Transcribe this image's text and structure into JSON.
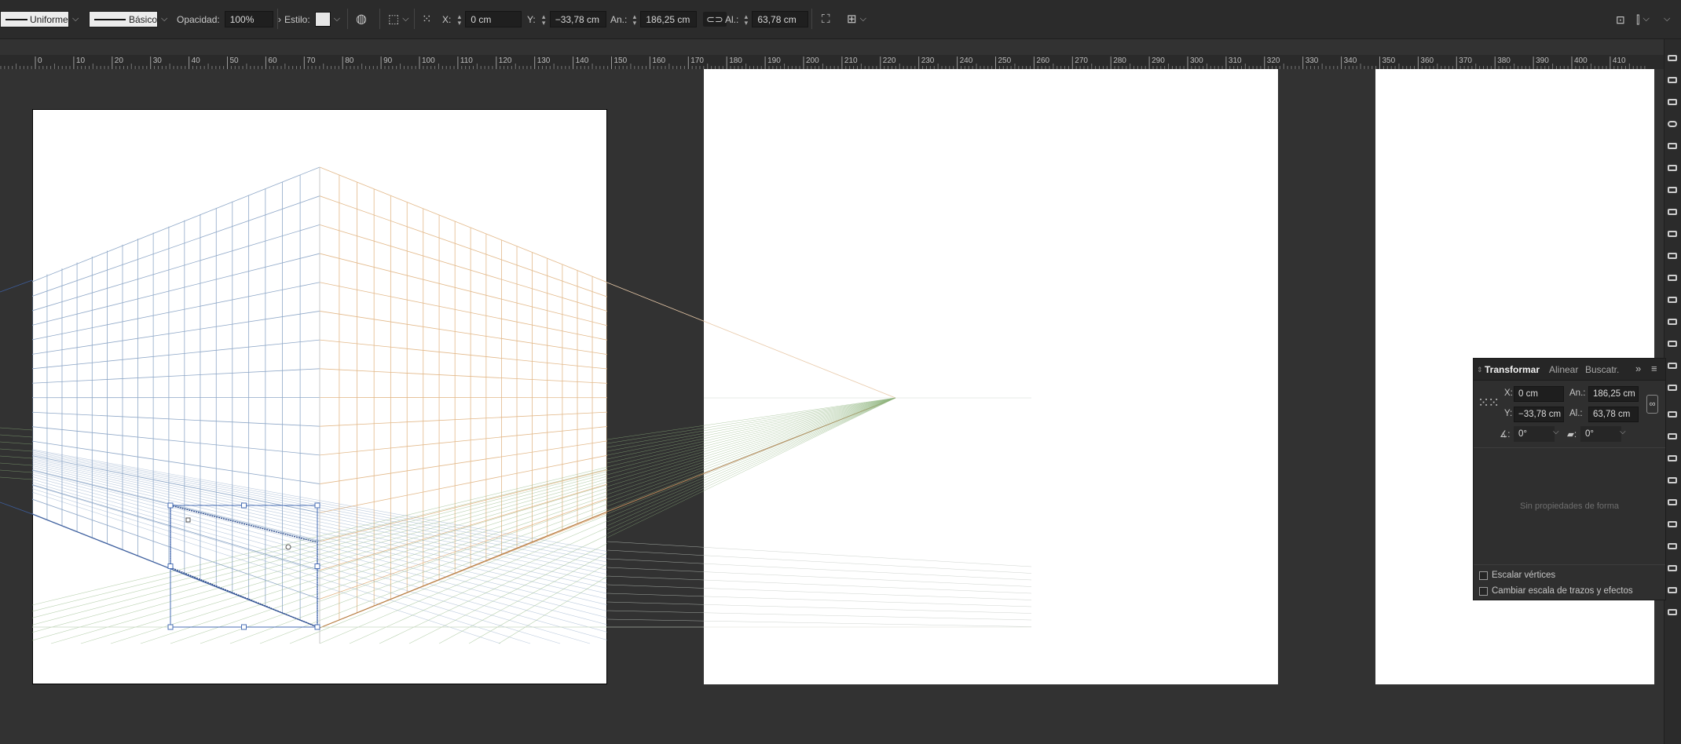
{
  "control_bar": {
    "stroke_profile": "Uniforme",
    "brush": "Básico",
    "opacity_label": "Opacidad:",
    "opacity_value": "100%",
    "style_label": "Estilo:",
    "x_label": "X:",
    "x_value": "0 cm",
    "y_label": "Y:",
    "y_value": "−33,78 cm",
    "width_label": "An.:",
    "width_value": "186,25 cm",
    "height_label": "Al.:",
    "height_value": "63,78 cm"
  },
  "ruler": {
    "ticks": [
      "0",
      "10",
      "20",
      "30",
      "40",
      "50",
      "60",
      "70",
      "80",
      "90",
      "100",
      "110",
      "120",
      "130",
      "140",
      "150",
      "160",
      "170",
      "180",
      "190",
      "200",
      "210",
      "220",
      "230",
      "240",
      "250",
      "260",
      "270",
      "280",
      "290",
      "300",
      "310",
      "320",
      "330",
      "340",
      "350",
      "360",
      "370",
      "380",
      "390",
      "400",
      "410"
    ]
  },
  "transform_panel": {
    "tabs": [
      "Transformar",
      "Alinear",
      "Buscatr."
    ],
    "x_label": "X:",
    "x_value": "0 cm",
    "y_label": "Y:",
    "y_value": "−33,78 cm",
    "width_label": "An.:",
    "width_value": "186,25 cm",
    "height_label": "Al.:",
    "height_value": "63,78 cm",
    "rotate_value": "0°",
    "shear_value": "0°",
    "empty_message": "Sin propiedades de forma",
    "scale_corners": "Escalar vértices",
    "scale_strokes": "Cambiar escala de trazos y efectos"
  },
  "colors": {
    "left_grid": "#8fa8c8",
    "right_grid": "#e3b98a",
    "ground_grid": "#9cbf8f",
    "selection": "#4a6fb5"
  }
}
